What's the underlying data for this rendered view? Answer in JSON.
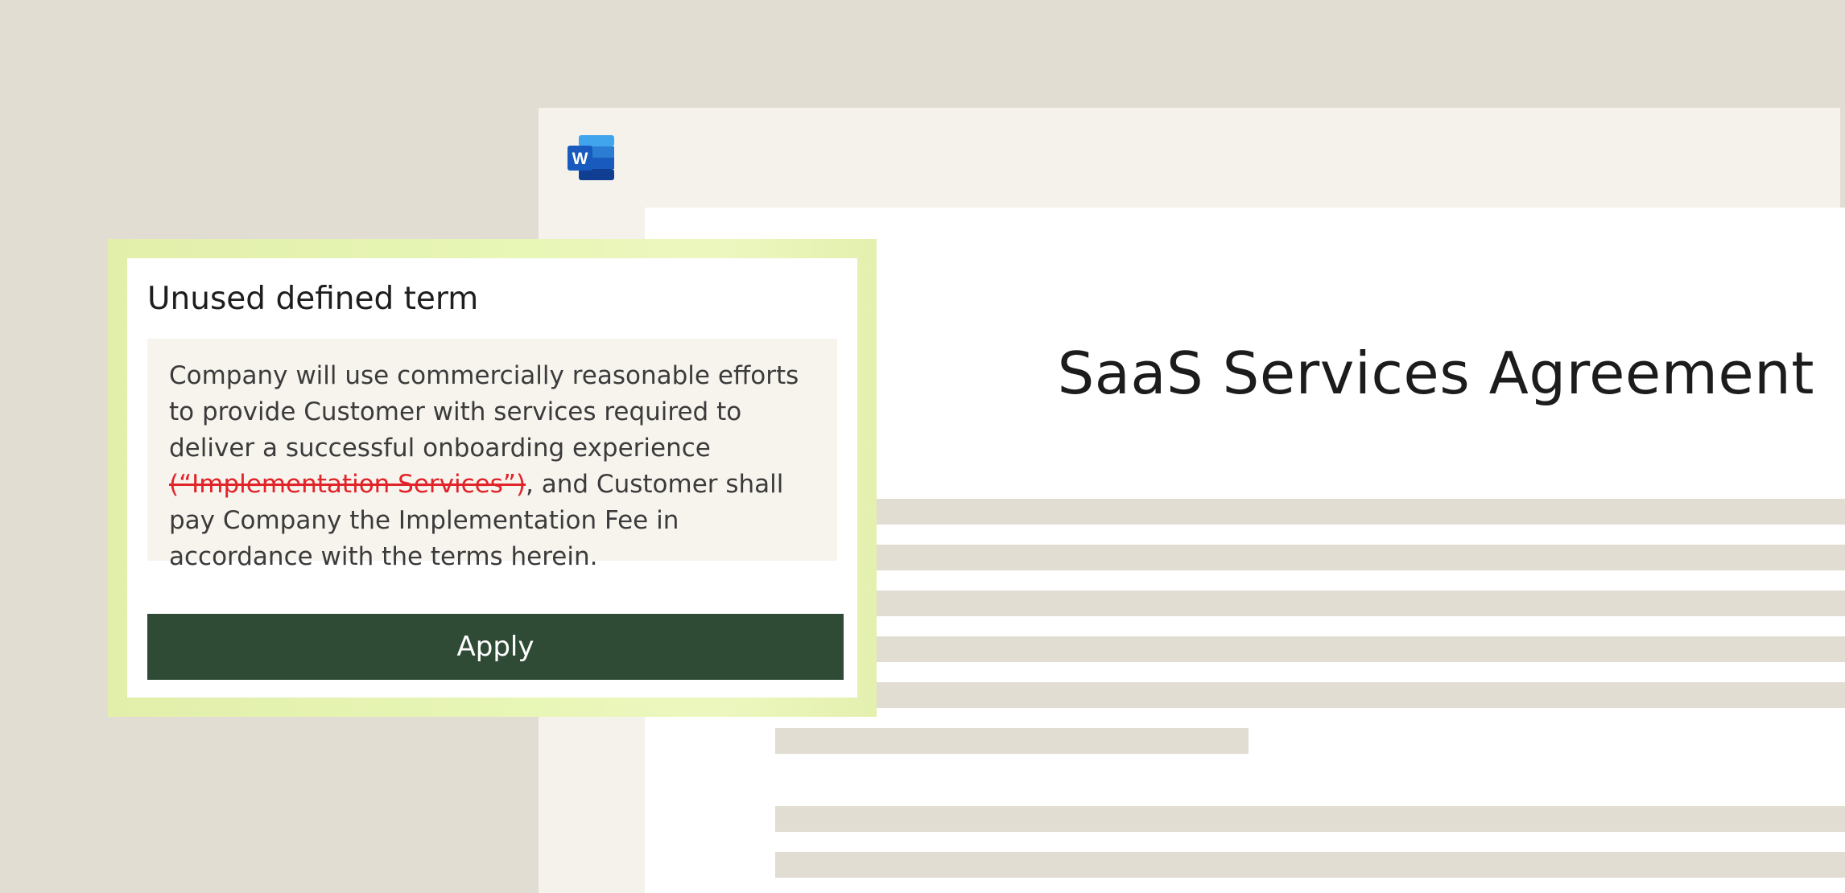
{
  "document": {
    "app_icon": "microsoft-word-icon",
    "app_icon_letter": "W",
    "title": "SaaS Services Agreement"
  },
  "suggestion_card": {
    "title": "Unused defined term",
    "text_before": "Company will use commercially reasonable efforts to provide Customer with services required to deliver a successful onboarding experience",
    "deleted_text": " (“Implementation Services”)",
    "text_after": ", and Customer shall pay Company the Implementation Fee in accordance with the terms herein.",
    "apply_label": "Apply"
  },
  "colors": {
    "background": "#e2ddd3",
    "button": "#2f4a35",
    "deletion": "#e0242a",
    "card_highlight": "#e8f6b6"
  }
}
